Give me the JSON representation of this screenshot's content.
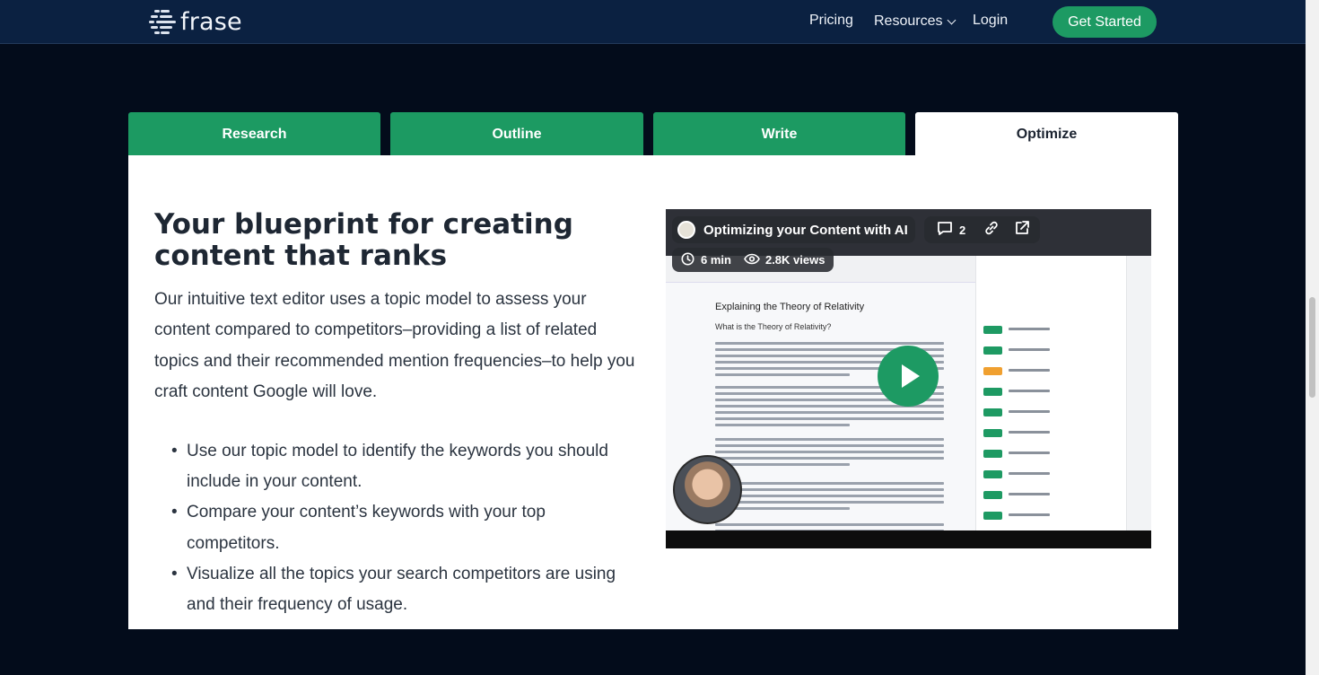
{
  "header": {
    "logo_text": "frase",
    "nav": {
      "pricing": "Pricing",
      "resources": "Resources",
      "login": "Login"
    },
    "cta_label": "Get Started"
  },
  "tabs": [
    {
      "label": "Research",
      "active": false
    },
    {
      "label": "Outline",
      "active": false
    },
    {
      "label": "Write",
      "active": false
    },
    {
      "label": "Optimize",
      "active": true
    }
  ],
  "content": {
    "heading": "Your blueprint for creating content that ranks",
    "description": "Our intuitive text editor uses a topic model to assess your content compared to competitors–providing a list of related topics and their recommended mention frequencies–to help you craft content Google will love.",
    "bullets": [
      "Use our topic model to identify the keywords you should include in your content.",
      "Compare your content’s keywords with your top competitors.",
      "Visualize all the topics your search competitors are using and their frequency of usage."
    ]
  },
  "video": {
    "title": "Optimizing your Content with AI",
    "comments_count": "2",
    "duration": "6 min",
    "views": "2.8K views",
    "doc_title": "Explaining the Theory of Relativity",
    "doc_subtitle": "What is the Theory of Relativity?"
  },
  "colors": {
    "brand_green": "#1d9a63",
    "header_bg": "#0b2141",
    "page_bg": "#030c1b"
  }
}
